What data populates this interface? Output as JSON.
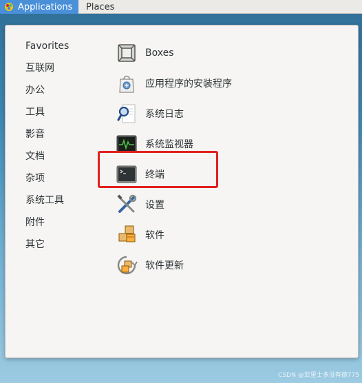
{
  "topbar": {
    "applications_label": "Applications",
    "places_label": "Places"
  },
  "categories": [
    "Favorites",
    "互联网",
    "办公",
    "工具",
    "影音",
    "文档",
    "杂项",
    "系统工具",
    "附件",
    "其它"
  ],
  "apps": [
    {
      "label": "Boxes",
      "icon": "boxes-icon"
    },
    {
      "label": "应用程序的安装程序",
      "icon": "software-installer-icon"
    },
    {
      "label": "系统日志",
      "icon": "system-log-icon"
    },
    {
      "label": "系统监视器",
      "icon": "system-monitor-icon"
    },
    {
      "label": "终端",
      "icon": "terminal-icon"
    },
    {
      "label": "设置",
      "icon": "settings-icon"
    },
    {
      "label": "软件",
      "icon": "software-icon"
    },
    {
      "label": "软件更新",
      "icon": "software-update-icon"
    }
  ],
  "highlight_color": "#e0211d",
  "accent_color": "#4a90d9",
  "watermark": "CSDN @亚里士多没有德775"
}
